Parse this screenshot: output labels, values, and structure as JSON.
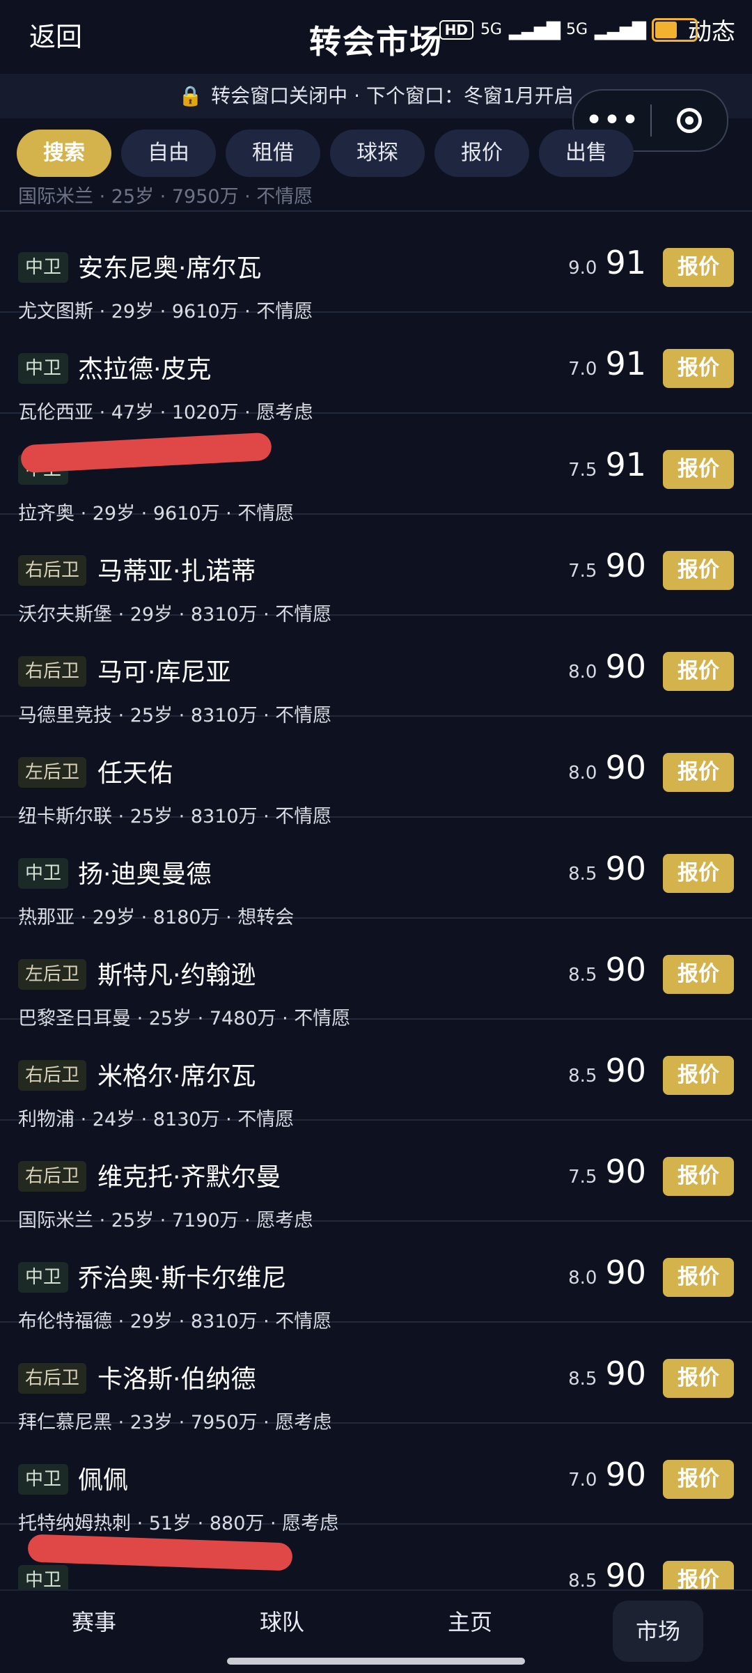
{
  "header": {
    "back_label": "返回",
    "title": "转会市场",
    "status": {
      "hd": "HD",
      "net1": "5G",
      "net2": "5G",
      "battery": "60",
      "dynamic": "动态"
    }
  },
  "banner": {
    "text": "转会窗口关闭中 · 下个窗口：冬窗1月开启"
  },
  "filters": [
    {
      "label": "搜索",
      "active": true
    },
    {
      "label": "自由"
    },
    {
      "label": "租借"
    },
    {
      "label": "球探"
    },
    {
      "label": "报价"
    },
    {
      "label": "出售"
    }
  ],
  "partial_row": {
    "sub": "国际米兰 · 25岁 · 7950万 · 不情愿"
  },
  "players": [
    {
      "pos": "中卫",
      "name": "安东尼奥·席尔瓦",
      "sub": "尤文图斯 · 29岁 · 9610万 · 不情愿",
      "form": "9.0",
      "overall": "91",
      "offer_label": "报价"
    },
    {
      "pos": "中卫",
      "name": "杰拉德·皮克",
      "sub": "瓦伦西亚 · 47岁 · 1020万 · 愿考虑",
      "form": "7.0",
      "overall": "91",
      "offer_label": "报价"
    },
    {
      "pos": "中卫",
      "name": "",
      "sub": "拉齐奥 · 29岁 · 9610万 · 不情愿",
      "form": "7.5",
      "overall": "91",
      "offer_label": "报价",
      "redacted": true
    },
    {
      "pos": "右后卫",
      "name": "马蒂亚·扎诺蒂",
      "sub": "沃尔夫斯堡 · 29岁 · 8310万 · 不情愿",
      "form": "7.5",
      "overall": "90",
      "offer_label": "报价"
    },
    {
      "pos": "右后卫",
      "name": "马可·库尼亚",
      "sub": "马德里竞技 · 25岁 · 8310万 · 不情愿",
      "form": "8.0",
      "overall": "90",
      "offer_label": "报价"
    },
    {
      "pos": "左后卫",
      "name": "任天佑",
      "sub": "纽卡斯尔联 · 25岁 · 8310万 · 不情愿",
      "form": "8.0",
      "overall": "90",
      "offer_label": "报价"
    },
    {
      "pos": "中卫",
      "name": "扬·迪奥曼德",
      "sub": "热那亚 · 29岁 · 8180万 · 想转会",
      "form": "8.5",
      "overall": "90",
      "offer_label": "报价"
    },
    {
      "pos": "左后卫",
      "name": "斯特凡·约翰逊",
      "sub": "巴黎圣日耳曼 · 25岁 · 7480万 · 不情愿",
      "form": "8.5",
      "overall": "90",
      "offer_label": "报价"
    },
    {
      "pos": "右后卫",
      "name": "米格尔·席尔瓦",
      "sub": "利物浦 · 24岁 · 8130万 · 不情愿",
      "form": "8.5",
      "overall": "90",
      "offer_label": "报价"
    },
    {
      "pos": "右后卫",
      "name": "维克托·齐默尔曼",
      "sub": "国际米兰 · 25岁 · 7190万 · 愿考虑",
      "form": "7.5",
      "overall": "90",
      "offer_label": "报价"
    },
    {
      "pos": "中卫",
      "name": "乔治奥·斯卡尔维尼",
      "sub": "布伦特福德 · 29岁 · 8310万 · 不情愿",
      "form": "8.0",
      "overall": "90",
      "offer_label": "报价"
    },
    {
      "pos": "右后卫",
      "name": "卡洛斯·伯纳德",
      "sub": "拜仁慕尼黑 · 23岁 · 7950万 · 愿考虑",
      "form": "8.5",
      "overall": "90",
      "offer_label": "报价"
    },
    {
      "pos": "中卫",
      "name": "佩佩",
      "sub": "托特纳姆热刺 · 51岁 · 880万 · 愿考虑",
      "form": "7.0",
      "overall": "90",
      "offer_label": "报价"
    },
    {
      "pos": "中卫",
      "name": "",
      "sub": "",
      "form": "8.5",
      "overall": "90",
      "offer_label": "报价",
      "redacted": true
    }
  ],
  "bottom_nav": [
    {
      "label": "赛事"
    },
    {
      "label": "球队"
    },
    {
      "label": "主页"
    },
    {
      "label": "市场",
      "active": true
    }
  ],
  "colors": {
    "background": "#0e1220",
    "accent": "#d4b24c",
    "redaction": "#e04848"
  }
}
